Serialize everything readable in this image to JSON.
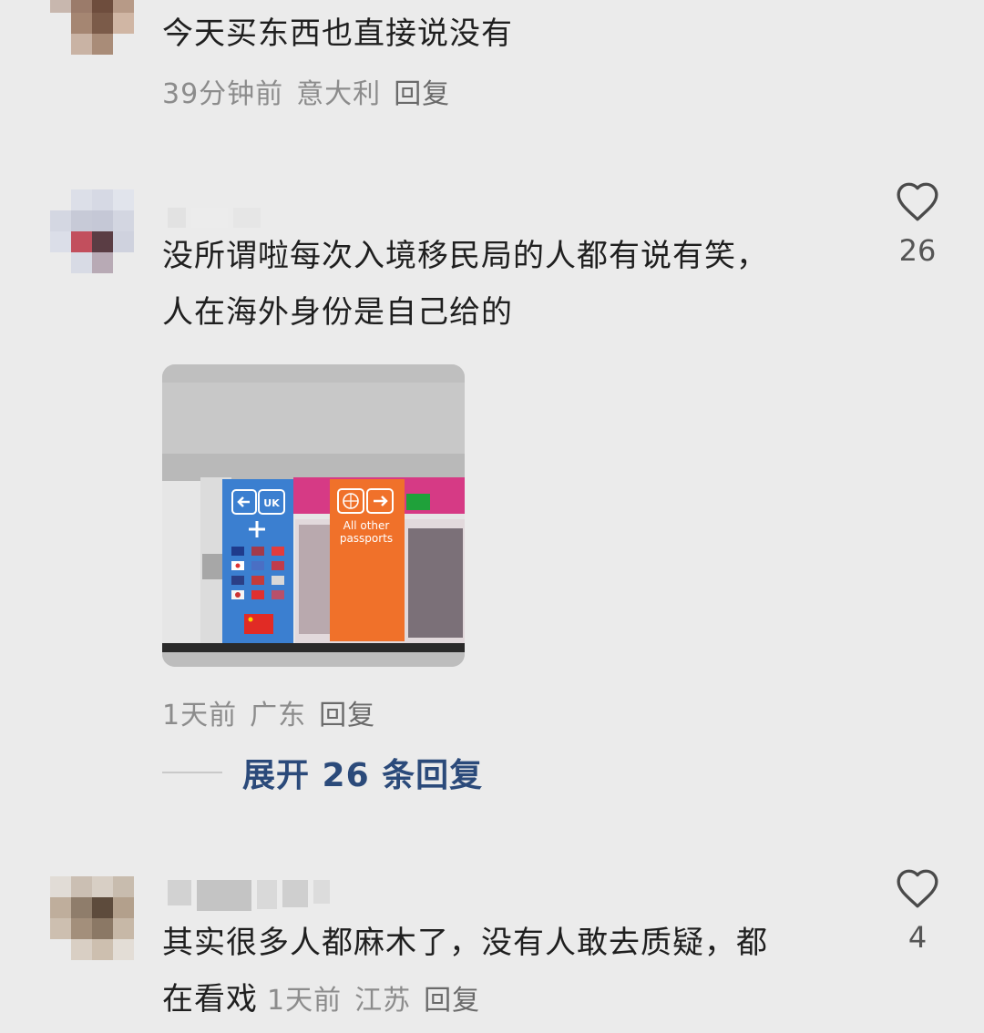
{
  "comments": [
    {
      "text": "今天买东西也直接说没有",
      "time": "39分钟前",
      "location": "意大利",
      "reply": "回复"
    },
    {
      "text_line1": "没所谓啦每次入境移民局的人都有说有笑，",
      "text_line2": "人在海外身份是自己给的",
      "likes": "26",
      "time": "1天前",
      "location": "广东",
      "reply": "回复",
      "expand": "展开 26 条回复",
      "photo": {
        "sign_left": "UK",
        "sign_right": "All other passports"
      }
    },
    {
      "text_line1": "其实很多人都麻木了，没有人敢去质疑，都",
      "text_line2": "在看戏",
      "likes": "4",
      "time": "1天前",
      "location": "江苏",
      "reply": "回复"
    }
  ],
  "colors": {
    "background": "#ebebeb",
    "meta_text": "#8c8c8c",
    "expand_link": "#2b4a7a",
    "uk_sign": "#3b7fd0",
    "other_sign": "#f0712a"
  },
  "icons": [
    "heart-outline-icon"
  ]
}
